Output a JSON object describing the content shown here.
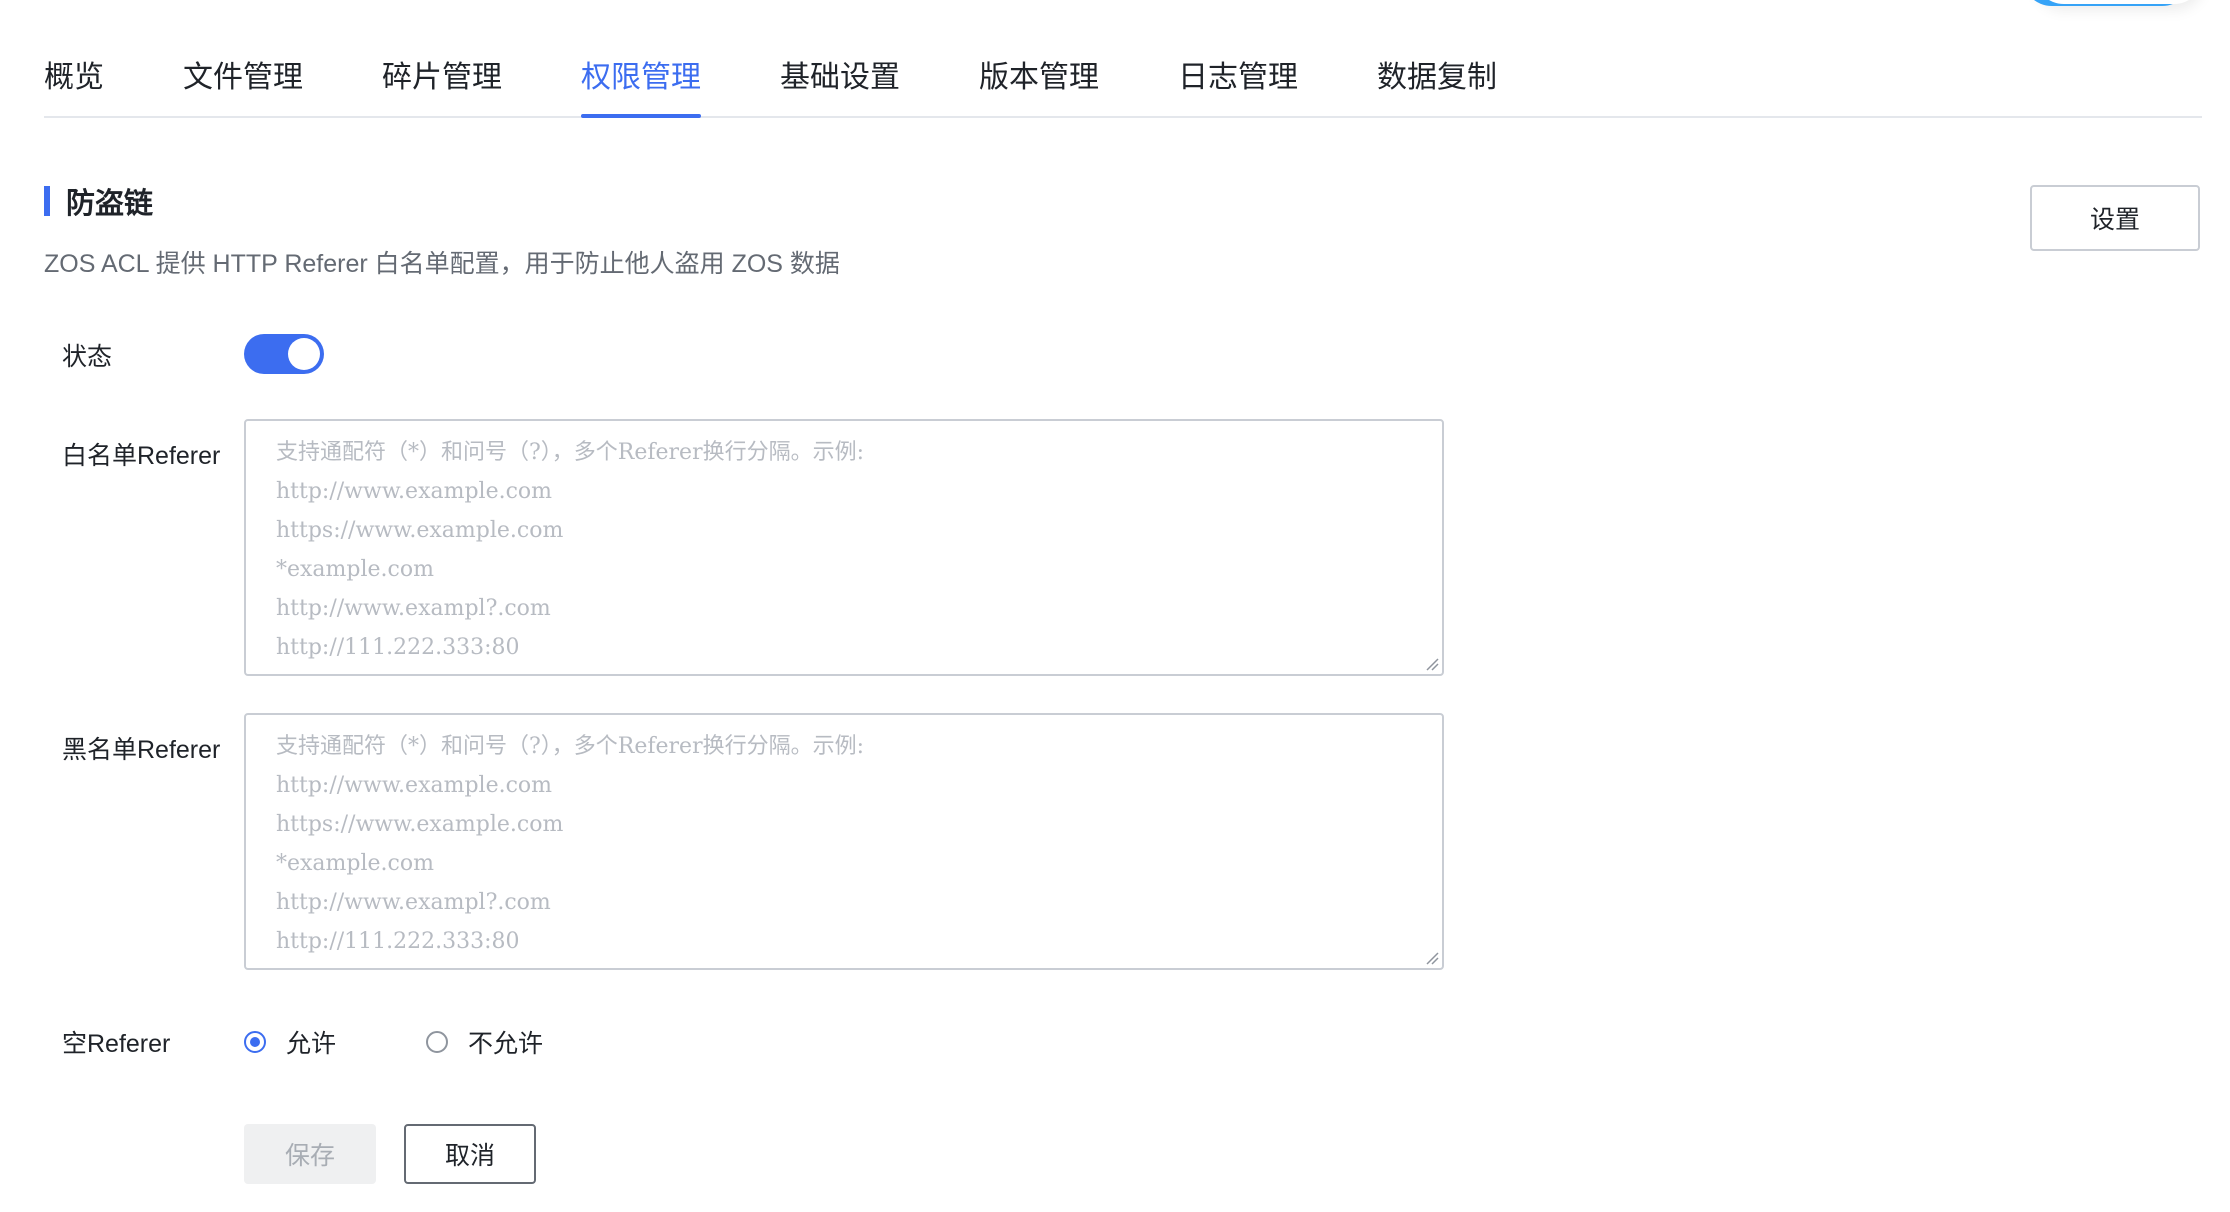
{
  "tabs": [
    {
      "label": "概览"
    },
    {
      "label": "文件管理"
    },
    {
      "label": "碎片管理"
    },
    {
      "label": "权限管理",
      "active": true
    },
    {
      "label": "基础设置"
    },
    {
      "label": "版本管理"
    },
    {
      "label": "日志管理"
    },
    {
      "label": "数据复制"
    }
  ],
  "section": {
    "title": "防盗链",
    "description": "ZOS ACL 提供 HTTP Referer 白名单配置，用于防止他人盗用 ZOS 数据",
    "settings_label": "设置"
  },
  "form": {
    "status_label": "状态",
    "status_on": true,
    "whitelist_label": "白名单Referer",
    "blacklist_label": "黑名单Referer",
    "placeholder_lines": [
      "支持通配符（*）和问号（?），多个Referer换行分隔。示例:",
      "http://www.example.com",
      "https://www.example.com",
      "*example.com",
      "http://www.exampl?.com",
      "http://111.222.333:80"
    ],
    "empty_referer_label": "空Referer",
    "empty_referer_options": [
      {
        "label": "允许",
        "checked": true
      },
      {
        "label": "不允许",
        "checked": false
      }
    ],
    "save_label": "保存",
    "cancel_label": "取消"
  },
  "colors": {
    "accent": "#3c6df0",
    "border": "#c9cdd4",
    "placeholder": "#b7bbc2"
  }
}
